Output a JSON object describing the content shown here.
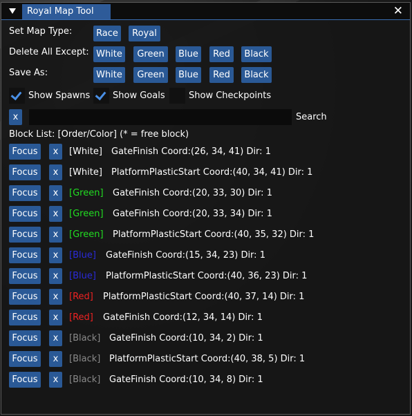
{
  "window": {
    "title": "Royal Map Tool",
    "close": "✕"
  },
  "map_type": {
    "label": "Set Map Type:",
    "buttons": [
      "Race",
      "Royal"
    ]
  },
  "delete_except": {
    "label": "Delete All Except:",
    "buttons": [
      "White",
      "Green",
      "Blue",
      "Red",
      "Black"
    ]
  },
  "save_as": {
    "label": "Save As:",
    "buttons": [
      "White",
      "Green",
      "Blue",
      "Red",
      "Black"
    ]
  },
  "checkboxes": [
    {
      "label": "Show Spawns",
      "checked": true
    },
    {
      "label": "Show Goals",
      "checked": true
    },
    {
      "label": "Show Checkpoints",
      "checked": false
    }
  ],
  "search": {
    "clear_label": "x",
    "value": "",
    "label": "Search"
  },
  "block_list": {
    "header": "Block List: [Order/Color] (* = free block)",
    "focus_label": "Focus",
    "remove_label": "x",
    "rows": [
      {
        "tag": "[White]",
        "color": "#ffffff",
        "desc": "GateFinish Coord:(26, 34, 41) Dir: 1"
      },
      {
        "tag": "[White]",
        "color": "#ffffff",
        "desc": "PlatformPlasticStart Coord:(40, 34, 41) Dir: 1"
      },
      {
        "tag": "[Green]",
        "color": "#22dd22",
        "desc": "GateFinish Coord:(20, 33, 30) Dir: 1"
      },
      {
        "tag": "[Green]",
        "color": "#22dd22",
        "desc": "GateFinish Coord:(20, 33, 34) Dir: 1"
      },
      {
        "tag": "[Green]",
        "color": "#22dd22",
        "desc": "PlatformPlasticStart Coord:(40, 35, 32) Dir: 1"
      },
      {
        "tag": "[Blue]",
        "color": "#2a2ad8",
        "desc": "GateFinish Coord:(15, 34, 23) Dir: 1"
      },
      {
        "tag": "[Blue]",
        "color": "#2a2ad8",
        "desc": "PlatformPlasticStart Coord:(40, 36, 23) Dir: 1"
      },
      {
        "tag": "[Red]",
        "color": "#ee2222",
        "desc": "PlatformPlasticStart Coord:(40, 37, 14) Dir: 1"
      },
      {
        "tag": "[Red]",
        "color": "#ee2222",
        "desc": "GateFinish Coord:(12, 34, 14) Dir: 1"
      },
      {
        "tag": "[Black]",
        "color": "#8a8a8a",
        "desc": "GateFinish Coord:(10, 34, 2) Dir: 1"
      },
      {
        "tag": "[Black]",
        "color": "#8a8a8a",
        "desc": "PlatformPlasticStart Coord:(40, 38, 5) Dir: 1"
      },
      {
        "tag": "[Black]",
        "color": "#8a8a8a",
        "desc": "GateFinish Coord:(10, 34, 8) Dir: 1"
      }
    ]
  },
  "colors": {
    "button": "#2a5996",
    "title_tab": "#2e5b99",
    "check": "#4a90e6"
  }
}
